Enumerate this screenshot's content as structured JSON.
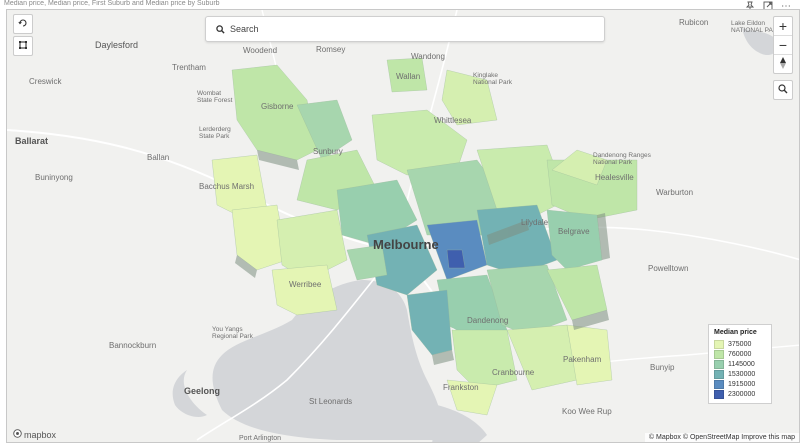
{
  "header": {
    "title": "Median price, Median price, First Suburb and Median price by Suburb",
    "icons": [
      "pin-icon",
      "focus-mode-icon",
      "more-options-icon"
    ]
  },
  "search": {
    "placeholder": "Search"
  },
  "places": [
    {
      "id": "rubicon",
      "name": "Rubicon"
    },
    {
      "id": "lake-eildon",
      "name": "Lake Eildon\nNATIONAL PARK"
    },
    {
      "id": "daylesford",
      "name": "Daylesford"
    },
    {
      "id": "woodend",
      "name": "Woodend"
    },
    {
      "id": "romsey",
      "name": "Romsey"
    },
    {
      "id": "wandong",
      "name": "Wandong"
    },
    {
      "id": "creswick",
      "name": "Creswick"
    },
    {
      "id": "trentham",
      "name": "Trentham"
    },
    {
      "id": "wallan",
      "name": "Wallan"
    },
    {
      "id": "kinglake",
      "name": "Kinglake\nNational Park"
    },
    {
      "id": "wombat",
      "name": "Wombat\nState Forest"
    },
    {
      "id": "gisborne",
      "name": "Gisborne"
    },
    {
      "id": "ballarat",
      "name": "Ballarat"
    },
    {
      "id": "lerderderg",
      "name": "Lerderderg\nState Park"
    },
    {
      "id": "whittlesea",
      "name": "Whittlesea"
    },
    {
      "id": "ballan",
      "name": "Ballan"
    },
    {
      "id": "sunbury",
      "name": "Sunbury"
    },
    {
      "id": "dandenong-ranges",
      "name": "Dandenong Ranges\nNational Park"
    },
    {
      "id": "buninyong",
      "name": "Buninyong"
    },
    {
      "id": "bacchus-marsh",
      "name": "Bacchus Marsh"
    },
    {
      "id": "healesville",
      "name": "Healesville"
    },
    {
      "id": "warburton",
      "name": "Warburton"
    },
    {
      "id": "lilydale",
      "name": "Lilydale"
    },
    {
      "id": "melbourne",
      "name": "Melbourne"
    },
    {
      "id": "belgrave",
      "name": "Belgrave"
    },
    {
      "id": "powelltown",
      "name": "Powelltown"
    },
    {
      "id": "werribee",
      "name": "Werribee"
    },
    {
      "id": "you-yangs",
      "name": "You Yangs\nRegional Park"
    },
    {
      "id": "dandenong",
      "name": "Dandenong"
    },
    {
      "id": "bannockburn",
      "name": "Bannockburn"
    },
    {
      "id": "pakenham",
      "name": "Pakenham"
    },
    {
      "id": "cranbourne",
      "name": "Cranbourne"
    },
    {
      "id": "bunyip",
      "name": "Bunyip"
    },
    {
      "id": "geelong",
      "name": "Geelong"
    },
    {
      "id": "frankston",
      "name": "Frankston"
    },
    {
      "id": "st-leonards",
      "name": "St Leonards"
    },
    {
      "id": "koo-wee-rup",
      "name": "Koo Wee Rup"
    },
    {
      "id": "port-arlington",
      "name": "Port Arlington"
    }
  ],
  "legend": {
    "title": "Median price",
    "items": [
      {
        "label": "375000",
        "color": "#e4f5b4"
      },
      {
        "label": "760000",
        "color": "#bfe6a8"
      },
      {
        "label": "1145000",
        "color": "#98cfae"
      },
      {
        "label": "1530000",
        "color": "#73b2b4"
      },
      {
        "label": "1915000",
        "color": "#5a8cc0"
      },
      {
        "label": "2300000",
        "color": "#3f5fae"
      }
    ]
  },
  "map_controls": {
    "zoom_in": "+",
    "zoom_out": "−"
  },
  "footer": {
    "logo": "mapbox",
    "attribution": "© Mapbox © OpenStreetMap Improve this map"
  }
}
